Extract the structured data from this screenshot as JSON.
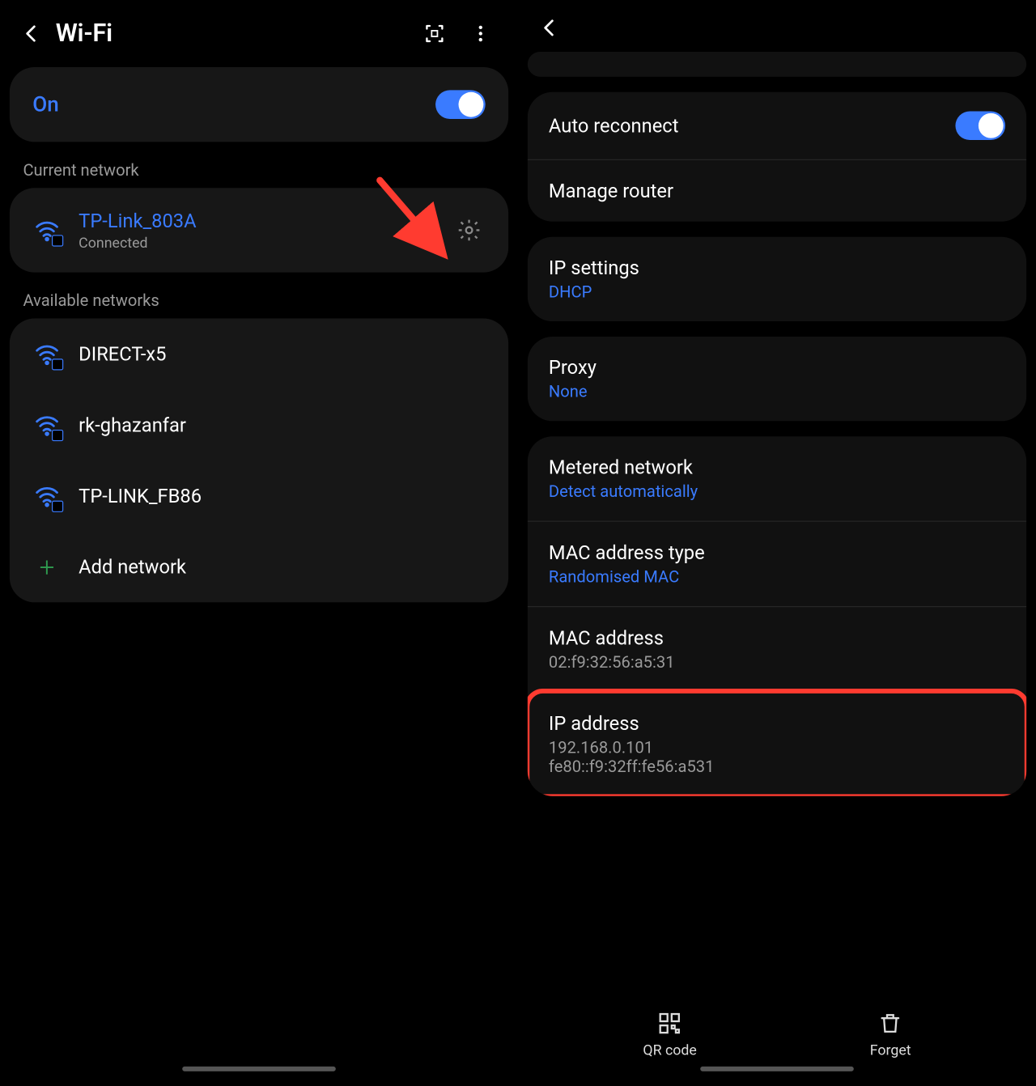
{
  "left": {
    "title": "Wi-Fi",
    "on_label": "On",
    "current_network_label": "Current network",
    "current_network": {
      "name": "TP-Link_803A",
      "status": "Connected"
    },
    "available_label": "Available networks",
    "available": [
      {
        "name": "DIRECT-x5"
      },
      {
        "name": "rk-ghazanfar"
      },
      {
        "name": "TP-LINK_FB86"
      }
    ],
    "add_network_label": "Add network"
  },
  "right": {
    "auto_reconnect_label": "Auto reconnect",
    "manage_router_label": "Manage router",
    "ip_settings_label": "IP settings",
    "ip_settings_value": "DHCP",
    "proxy_label": "Proxy",
    "proxy_value": "None",
    "metered_label": "Metered network",
    "metered_value": "Detect automatically",
    "mac_type_label": "MAC address type",
    "mac_type_value": "Randomised MAC",
    "mac_addr_label": "MAC address",
    "mac_addr_value": "02:f9:32:56:a5:31",
    "ip_addr_label": "IP address",
    "ip_addr_v4": "192.168.0.101",
    "ip_addr_v6": "fe80::f9:32ff:fe56:a531",
    "bottom": {
      "qr_label": "QR code",
      "forget_label": "Forget"
    }
  },
  "colors": {
    "accent": "#3a7bff",
    "highlight": "#ff3b30"
  }
}
